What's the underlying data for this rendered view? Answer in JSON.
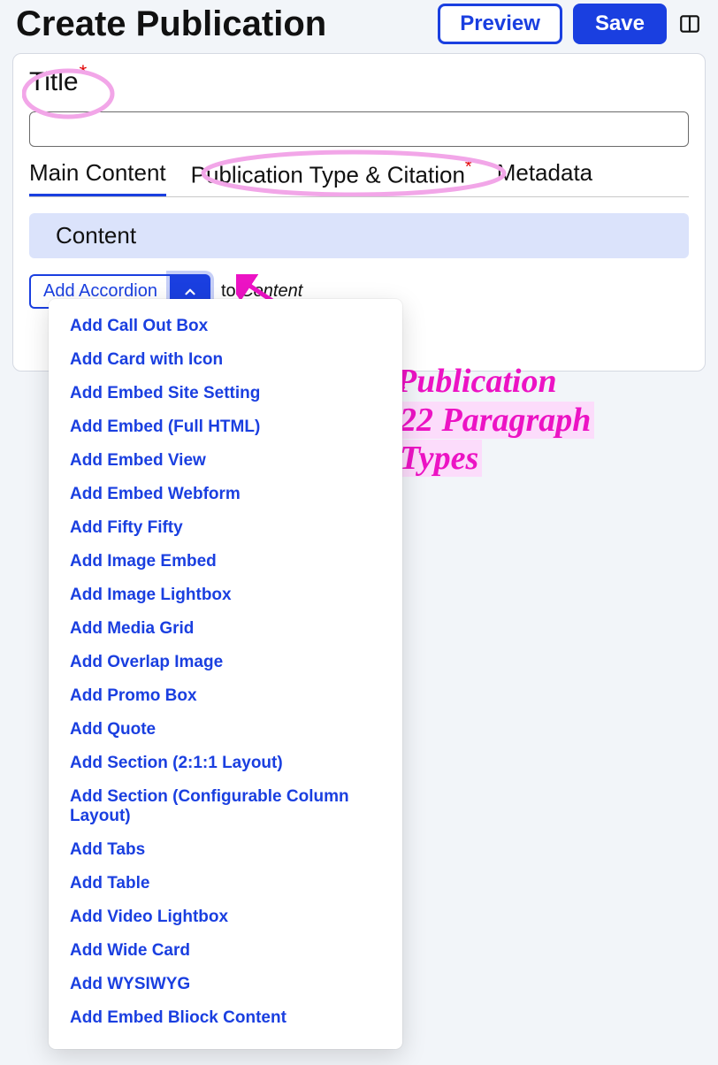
{
  "header": {
    "title": "Create Publication",
    "preview_label": "Preview",
    "save_label": "Save"
  },
  "title_field": {
    "label": "Title",
    "required_marker": "*",
    "value": ""
  },
  "tabs": {
    "main": "Main Content",
    "type_citation": "Publication Type & Citation",
    "type_citation_required_marker": "*",
    "metadata": "Metadata"
  },
  "content_section": {
    "heading": "Content",
    "add_button": "Add Accordion",
    "to_word": "to",
    "to_target": "Content"
  },
  "dropdown_items": [
    "Add Call Out Box",
    "Add Card with Icon",
    "Add Embed Site Setting",
    "Add Embed (Full HTML)",
    "Add Embed View",
    "Add Embed Webform",
    "Add Fifty Fifty",
    "Add Image Embed",
    "Add Image Lightbox",
    "Add Media Grid",
    "Add Overlap Image",
    "Add Promo Box",
    "Add Quote",
    "Add Section (2:1:1 Layout)",
    "Add Section (Configurable Column Layout)",
    "Add Tabs",
    "Add Table",
    "Add Video Lightbox",
    "Add Wide Card",
    "Add WYSIWYG",
    "Add Embed Bliock Content"
  ],
  "annotation": {
    "line1": "Publication",
    "line2": "22 Paragraph",
    "line3": "Types"
  }
}
